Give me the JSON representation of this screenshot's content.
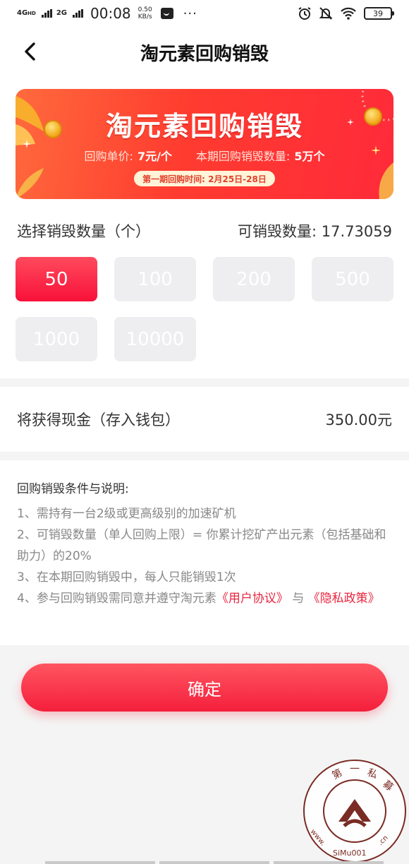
{
  "status_bar": {
    "network_1": "4G",
    "network_1_sup": "HD",
    "network_2": "2G",
    "time": "00:08",
    "speed_value": "0.50",
    "speed_unit": "KB/s",
    "more": "···",
    "battery": "39"
  },
  "nav": {
    "title": "淘元素回购销毁",
    "back_icon": "chevron-left-icon"
  },
  "banner": {
    "title": "淘元素回购销毁",
    "unit_price_label": "回购单价:",
    "unit_price_value": "7元/个",
    "quantity_label": "本期回购销毁数量:",
    "quantity_value": "5万个",
    "period": "第一期回购时间: 2月25日-28日",
    "colors": {
      "start": "#ff6a3d",
      "end": "#ff2a3a"
    }
  },
  "quantity": {
    "label": "选择销毁数量（个）",
    "available_label": "可销毁数量:",
    "available_value": "17.73059",
    "options": [
      "50",
      "100",
      "200",
      "500",
      "1000",
      "10000"
    ],
    "selected": "50"
  },
  "cash": {
    "label": "将获得现金（存入钱包）",
    "value": "350.00元"
  },
  "rules": {
    "title": "回购销毁条件与说明:",
    "items": [
      "1、需持有一台2级或更高级别的加速矿机",
      "2、可销毁数量（单人回购上限）= 你累计挖矿产出元素（包括基础和助力）的20%",
      "3、在本期回购销毁中，每人只能销毁1次"
    ],
    "item4_prefix": "4、参与回购销毁需同意并遵守淘元素",
    "user_agreement": "《用户协议》",
    "joiner": "与",
    "privacy_policy": "《隐私政策》"
  },
  "confirm_label": "确定",
  "watermark": {
    "text_top": "第一私募",
    "text_bottom": "www.SiMu001.cn"
  },
  "accent_color": "#f41f3c"
}
